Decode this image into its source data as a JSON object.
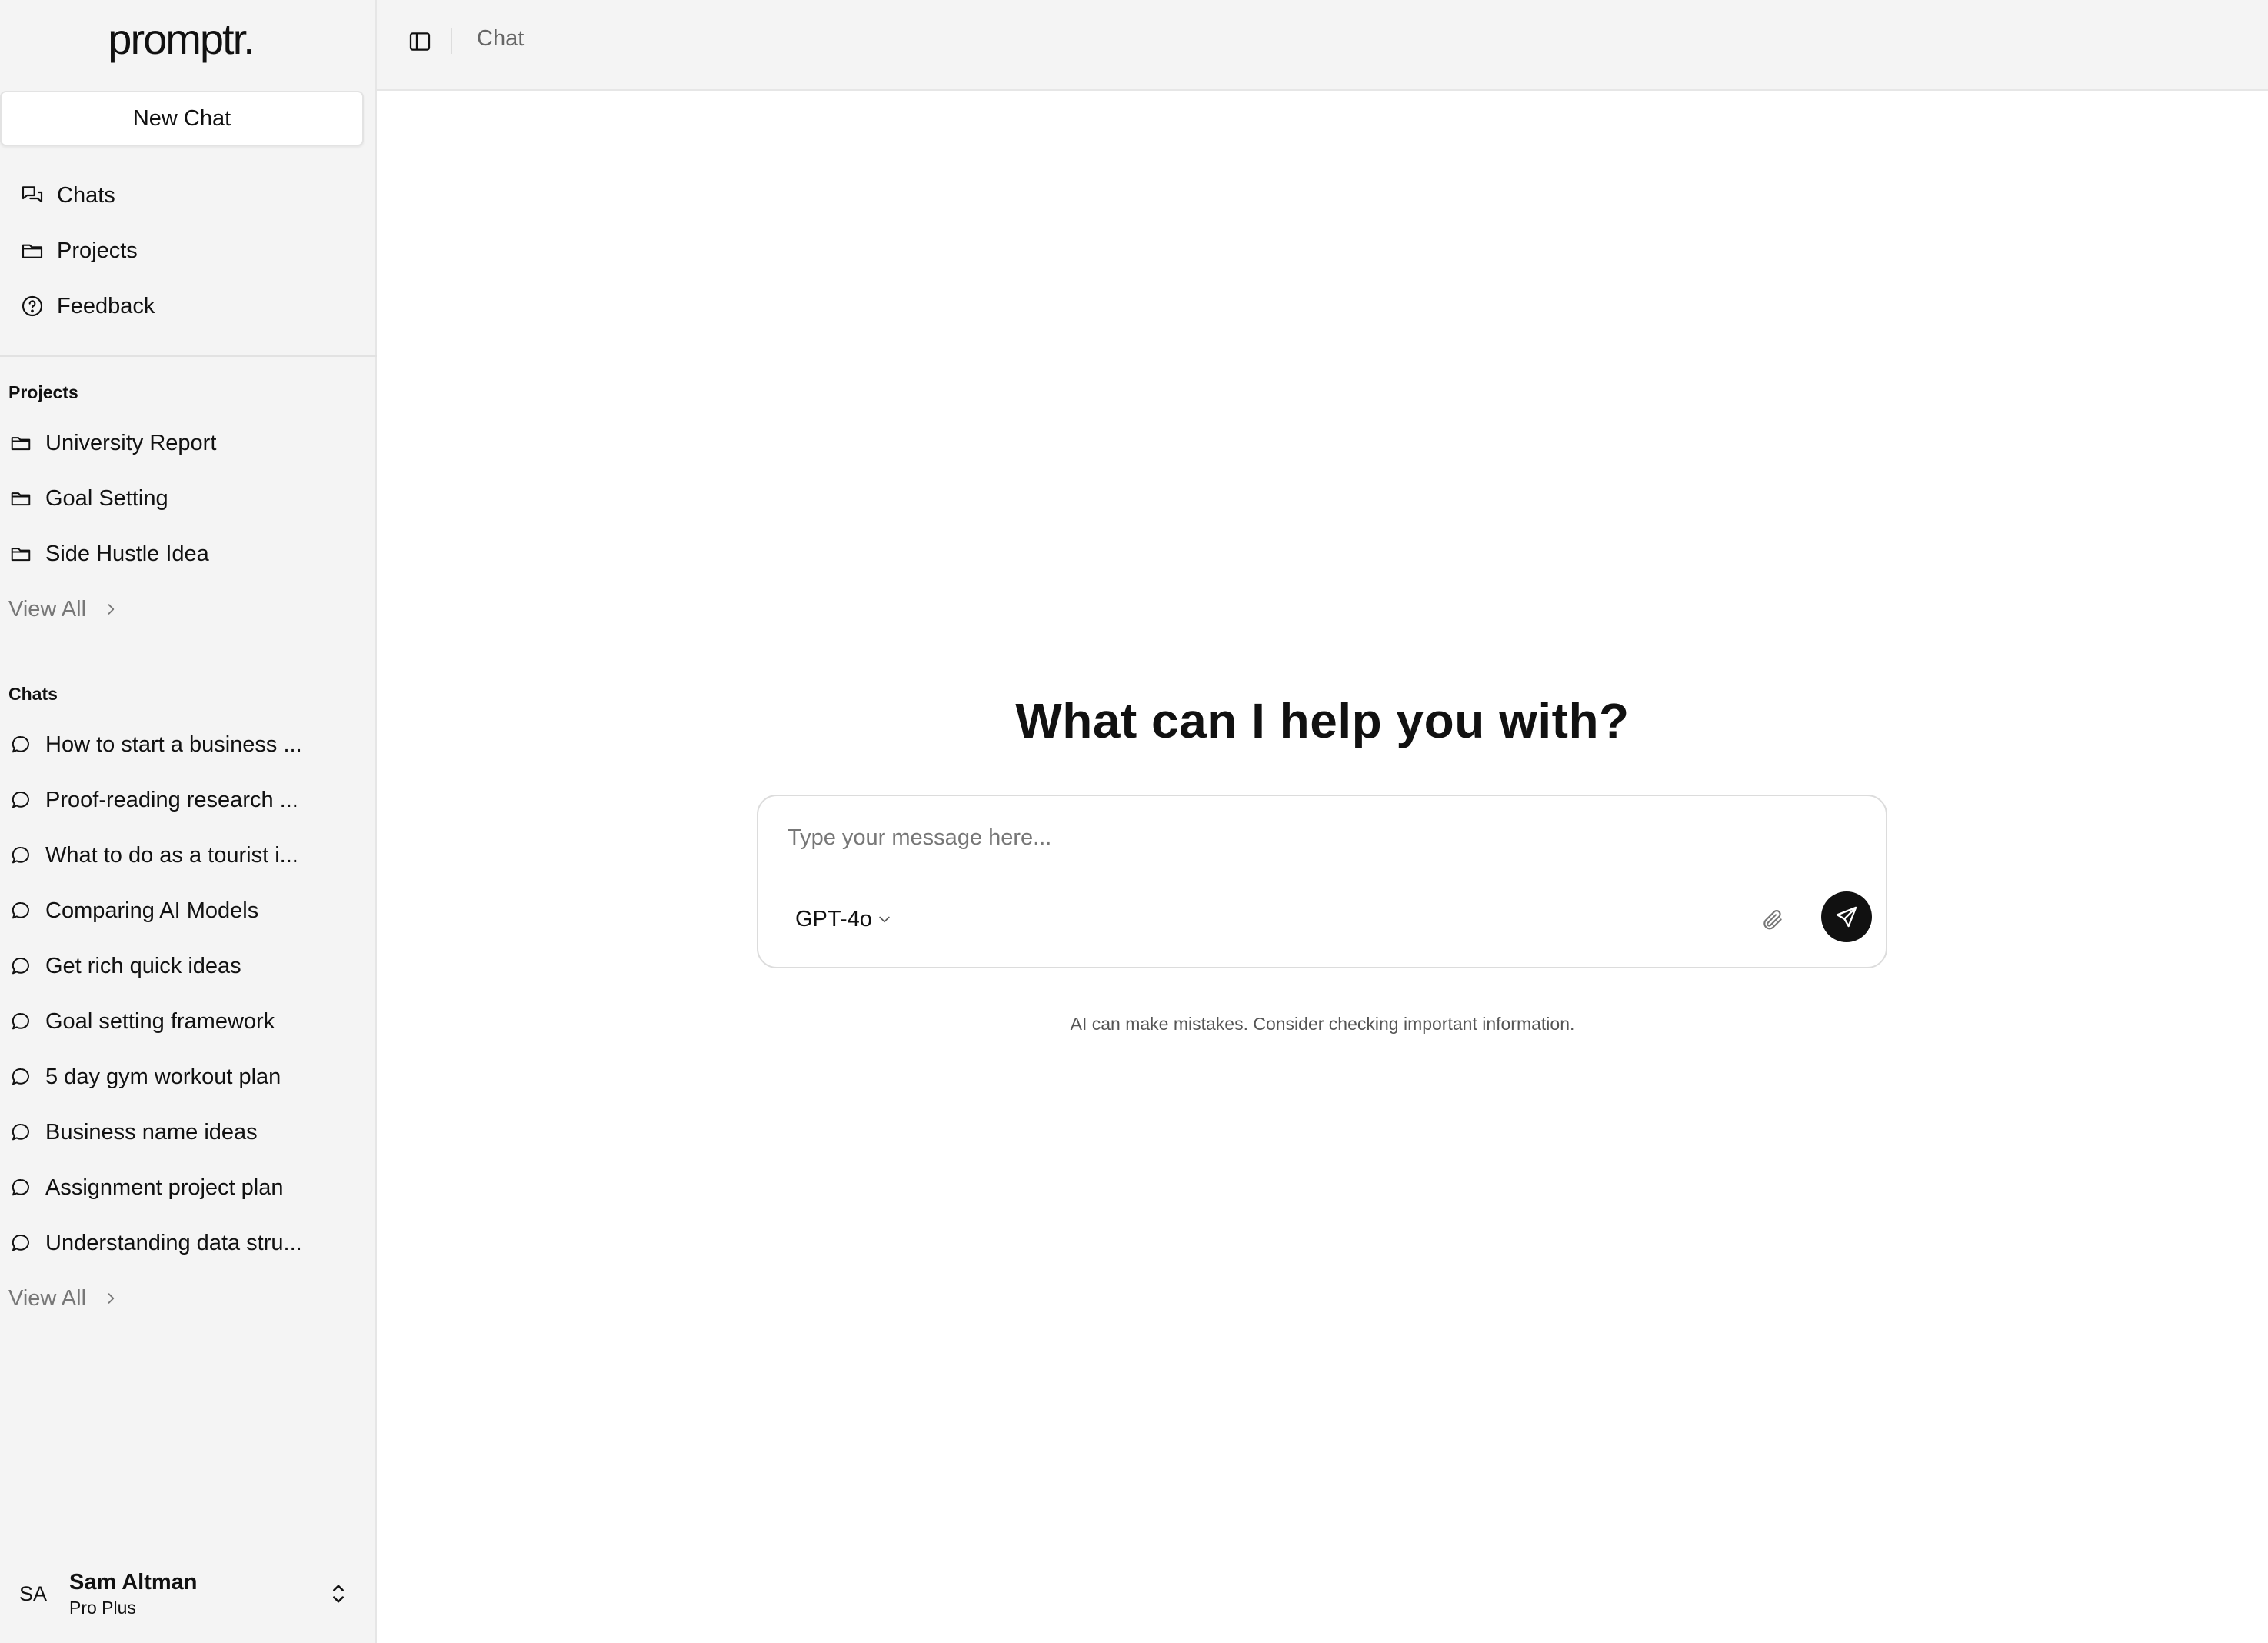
{
  "app": {
    "logo": "promptr."
  },
  "sidebar": {
    "new_chat_label": "New Chat",
    "nav": [
      {
        "label": "Chats",
        "icon": "chats-icon"
      },
      {
        "label": "Projects",
        "icon": "folder-icon"
      },
      {
        "label": "Feedback",
        "icon": "help-circle-icon"
      }
    ],
    "projects_title": "Projects",
    "projects": [
      {
        "label": "University Report",
        "icon": "folder-icon"
      },
      {
        "label": "Goal Setting",
        "icon": "folder-icon"
      },
      {
        "label": "Side Hustle Idea",
        "icon": "folder-icon"
      }
    ],
    "projects_view_all": "View All",
    "chats_title": "Chats",
    "chats": [
      {
        "label": "How to start a business ...",
        "icon": "message-icon"
      },
      {
        "label": "Proof-reading research ...",
        "icon": "message-icon"
      },
      {
        "label": "What to do as a tourist i...",
        "icon": "message-icon"
      },
      {
        "label": "Comparing AI Models",
        "icon": "message-icon"
      },
      {
        "label": "Get rich quick ideas",
        "icon": "message-icon"
      },
      {
        "label": "Goal setting framework",
        "icon": "message-icon"
      },
      {
        "label": "5 day gym workout plan",
        "icon": "message-icon"
      },
      {
        "label": "Business name ideas",
        "icon": "message-icon"
      },
      {
        "label": "Assignment project plan",
        "icon": "message-icon"
      },
      {
        "label": "Understanding data stru...",
        "icon": "message-icon"
      }
    ],
    "chats_view_all": "View All",
    "user": {
      "initials": "SA",
      "name": "Sam Altman",
      "plan": "Pro Plus"
    }
  },
  "header": {
    "breadcrumb": "Chat"
  },
  "main": {
    "headline": "What can I help you with?",
    "input_placeholder": "Type your message here...",
    "input_value": "",
    "model": "GPT-4o",
    "disclaimer": "AI can make mistakes. Consider checking important information."
  },
  "colors": {
    "sidebar_bg": "#f4f4f4",
    "send_button": "#111111",
    "muted_text": "#777777"
  }
}
